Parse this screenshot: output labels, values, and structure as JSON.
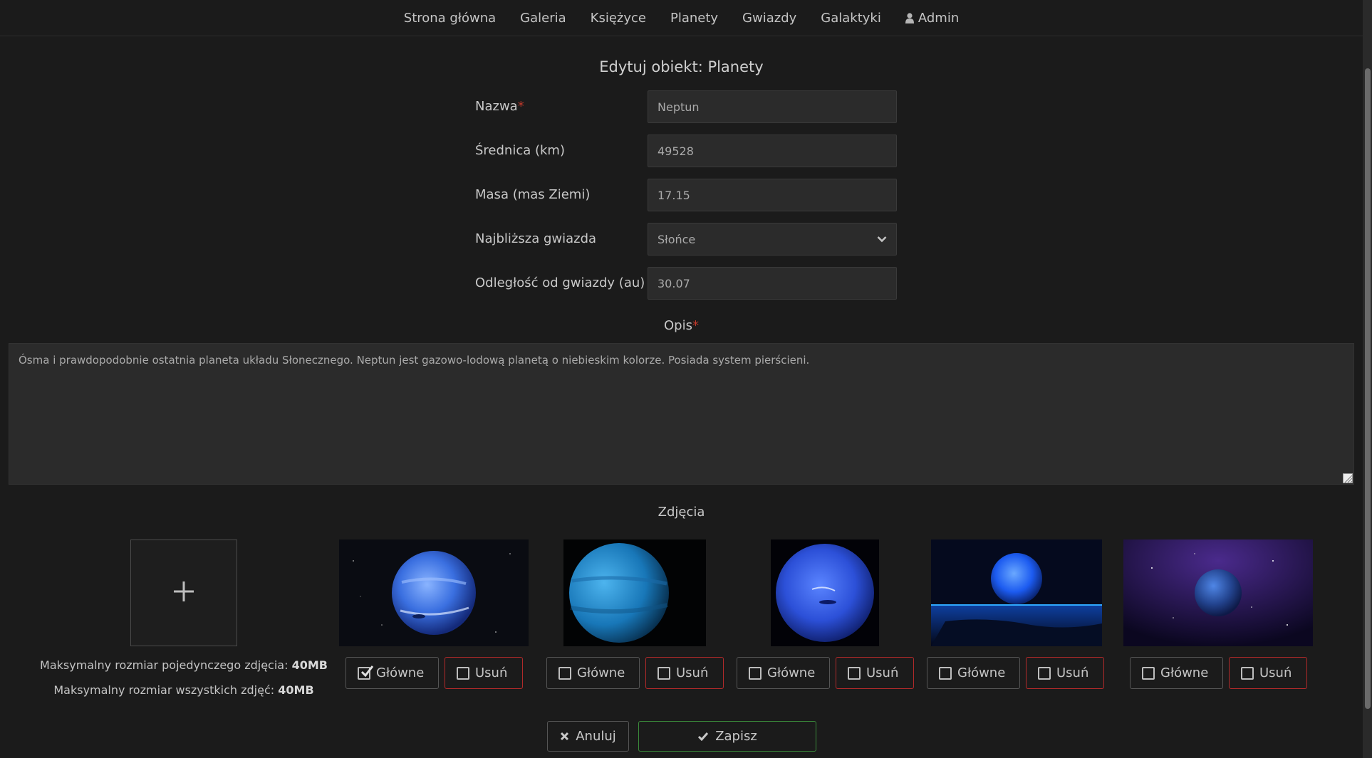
{
  "nav": {
    "items": [
      "Strona główna",
      "Galeria",
      "Księżyce",
      "Planety",
      "Gwiazdy",
      "Galaktyki"
    ],
    "admin_label": "Admin",
    "admin_icon": "user-icon"
  },
  "form": {
    "title": "Edytuj obiekt: Planety",
    "fields": {
      "name": {
        "label": "Nazwa",
        "required_mark": "*",
        "value": "Neptun"
      },
      "diameter": {
        "label": "Średnica (km)",
        "value": "49528"
      },
      "mass": {
        "label": "Masa (mas Ziemi)",
        "value": "17.15"
      },
      "nearest_star": {
        "label": "Najbliższa gwiazda",
        "value": "Słońce",
        "icon": "chevron-down-icon"
      },
      "distance": {
        "label": "Odległość od gwiazdy (au)",
        "value": "30.07"
      }
    },
    "description": {
      "label": "Opis",
      "required_mark": "*",
      "value": "Ósma i prawdopodobnie ostatnia planeta układu Słonecznego. Neptun jest gazowo-lodową planetą o niebieskim kolorze. Posiada system pierścieni."
    }
  },
  "photos": {
    "label": "Zdjęcia",
    "add_icon": "plus-icon",
    "limit_single_prefix": "Maksymalny rozmiar pojedynczego zdjęcia:",
    "limit_single_value": "40MB",
    "limit_total_prefix": "Maksymalny rozmiar wszystkich zdjęć:",
    "limit_total_value": "40MB",
    "main_label": "Główne",
    "delete_label": "Usuń",
    "items": [
      {
        "main_checked": true,
        "delete_checked": false
      },
      {
        "main_checked": false,
        "delete_checked": false
      },
      {
        "main_checked": false,
        "delete_checked": false
      },
      {
        "main_checked": false,
        "delete_checked": false
      },
      {
        "main_checked": false,
        "delete_checked": false
      }
    ]
  },
  "actions": {
    "cancel_label": "Anuluj",
    "cancel_icon": "close-icon",
    "save_label": "Zapisz",
    "save_icon": "check-icon"
  },
  "colors": {
    "background": "#1b1b1b",
    "required": "#c0392b",
    "danger_border": "#b02a2a",
    "success_border": "#3a8a3a"
  }
}
